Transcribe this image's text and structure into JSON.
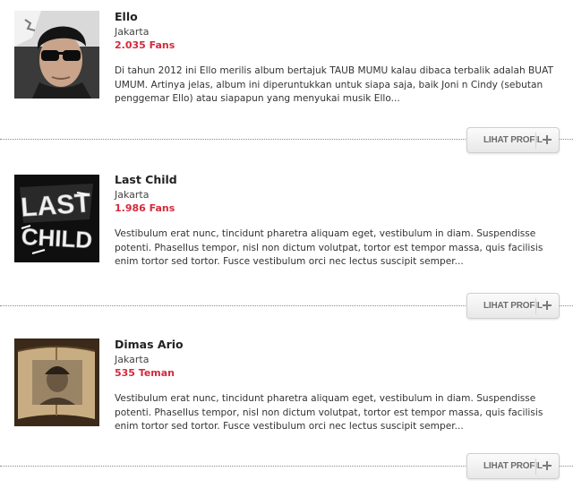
{
  "profiles": [
    {
      "name": "Ello",
      "city": "Jakarta",
      "followers": "2.035 Fans",
      "description": "Di tahun 2012 ini Ello merilis album bertajuk  TAUB MUMU kalau dibaca terbalik adalah BUAT UMUM. Artinya jelas, album ini diperuntukkan untuk siapa saja, baik Joni n Cindy (sebutan penggemar Ello) atau siapapun yang menyukai musik Ello...",
      "button_label": "Lihat Profil"
    },
    {
      "name": "Last Child",
      "city": "Jakarta",
      "followers": "1.986 Fans",
      "description": "Vestibulum erat nunc, tincidunt pharetra aliquam eget, vestibulum in diam. Suspendisse potenti. Phasellus tempor, nisl non dictum volutpat, tortor est tempor massa, quis facilisis enim tortor sed tortor. Fusce vestibulum orci nec lectus suscipit semper...",
      "button_label": "Lihat Profil",
      "logo_text": [
        "LAST",
        "CHILD"
      ]
    },
    {
      "name": "Dimas Ario",
      "city": "Jakarta",
      "followers": "535 Teman",
      "description": "Vestibulum erat nunc, tincidunt pharetra aliquam eget, vestibulum in diam. Suspendisse potenti. Phasellus tempor, nisl non dictum volutpat, tortor est tempor massa, quis facilisis enim tortor sed tortor. Fusce vestibulum orci nec lectus suscipit semper...",
      "button_label": "Lihat Profil"
    }
  ],
  "colors": {
    "accent": "#d42a3c",
    "text": "#333333",
    "divider": "#8a8a8a",
    "button_text": "#6d6d6d"
  }
}
